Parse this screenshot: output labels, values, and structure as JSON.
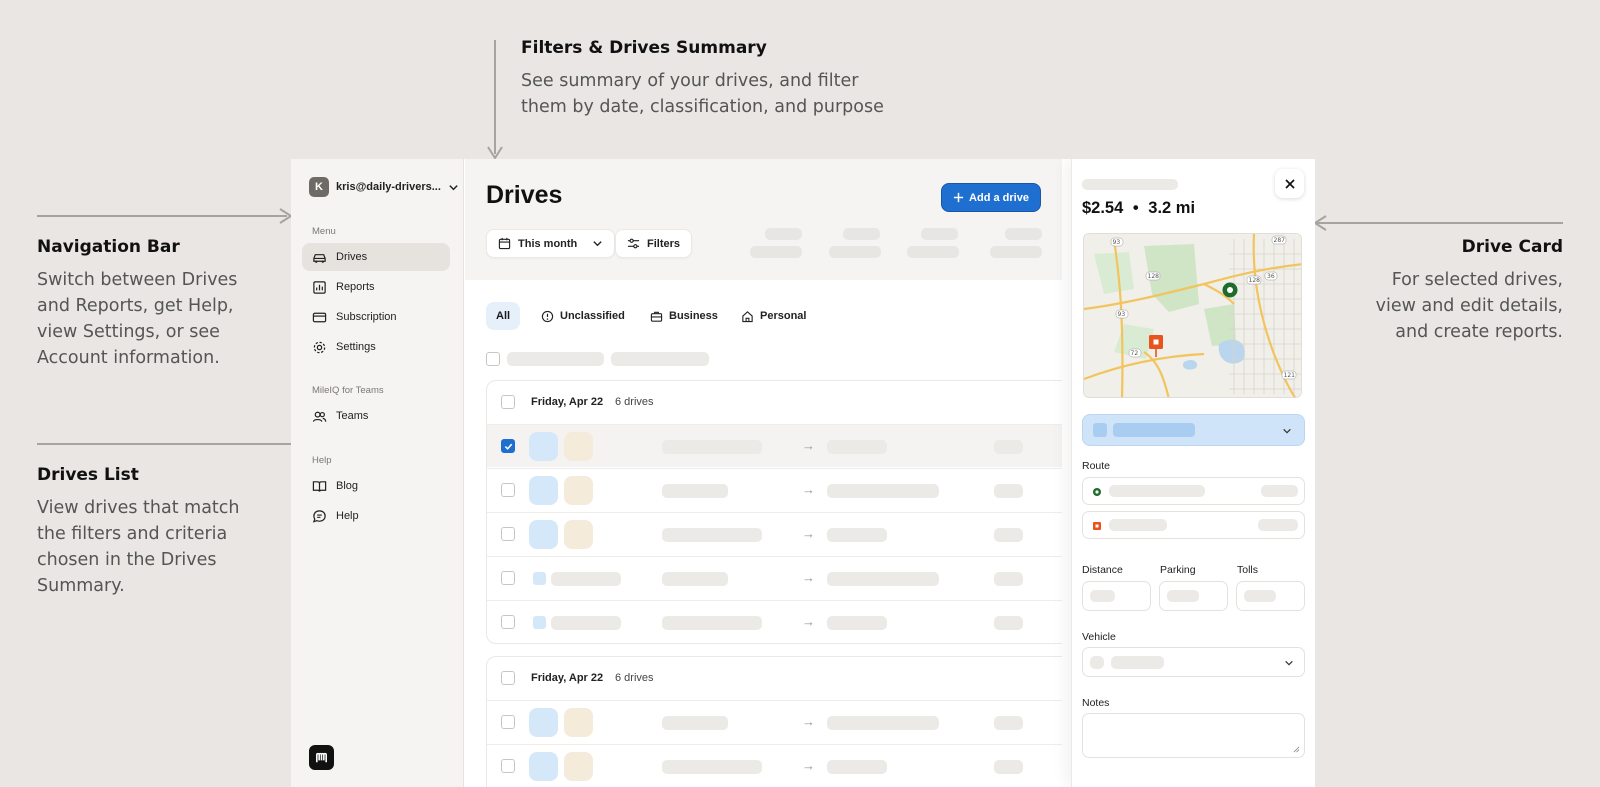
{
  "annotations": {
    "filters": {
      "title": "Filters & Drives Summary",
      "body": "See summary of your drives, and filter them by date, classification, and purpose"
    },
    "navigation": {
      "title": "Navigation Bar",
      "body": "Switch between Drives and Reports, get Help, view Settings, or see Account information."
    },
    "drives_list": {
      "title": "Drives List",
      "body": "View drives that match the filters and criteria chosen in the Drives Summary."
    },
    "drive_card": {
      "title": "Drive Card",
      "body": "For selected drives, view and edit details, and create reports."
    }
  },
  "sidebar": {
    "avatar_initial": "K",
    "account_email": "kris@daily-drivers...",
    "menu_label": "Menu",
    "menu_items": [
      {
        "label": "Drives",
        "icon": "car-icon",
        "active": true
      },
      {
        "label": "Reports",
        "icon": "chart-icon",
        "active": false
      },
      {
        "label": "Subscription",
        "icon": "credit-card-icon",
        "active": false
      },
      {
        "label": "Settings",
        "icon": "gear-icon",
        "active": false
      }
    ],
    "teams_label": "MileIQ for Teams",
    "teams_item": {
      "label": "Teams",
      "icon": "users-icon"
    },
    "help_label": "Help",
    "help_items": [
      {
        "label": "Blog",
        "icon": "book-icon"
      },
      {
        "label": "Help",
        "icon": "chat-icon"
      }
    ]
  },
  "main": {
    "title": "Drives",
    "add_button": "Add a drive",
    "date_filter": "This month",
    "filters_button": "Filters",
    "tabs": [
      {
        "label": "All",
        "active": true
      },
      {
        "label": "Unclassified",
        "icon": "alert-circle-icon"
      },
      {
        "label": "Business",
        "icon": "briefcase-icon"
      },
      {
        "label": "Personal",
        "icon": "home-icon"
      }
    ],
    "groups": [
      {
        "date": "Friday, Apr 22",
        "count": "6 drives"
      },
      {
        "date": "Friday, Apr 22",
        "count": "6 drives"
      }
    ]
  },
  "drive_card": {
    "amount": "$2.54",
    "separator": "•",
    "distance": "3.2 mi",
    "route_label": "Route",
    "distance_label": "Distance",
    "parking_label": "Parking",
    "tolls_label": "Tolls",
    "vehicle_label": "Vehicle",
    "notes_label": "Notes",
    "map_labels": [
      "93",
      "287",
      "128",
      "36",
      "128",
      "93",
      "72",
      "121"
    ]
  },
  "colors": {
    "accent": "#1f6fd1",
    "background": "#e9e6e3",
    "sidebar": "#f5f4f2",
    "start_marker": "#1e6b2c",
    "end_marker": "#e8531e"
  }
}
